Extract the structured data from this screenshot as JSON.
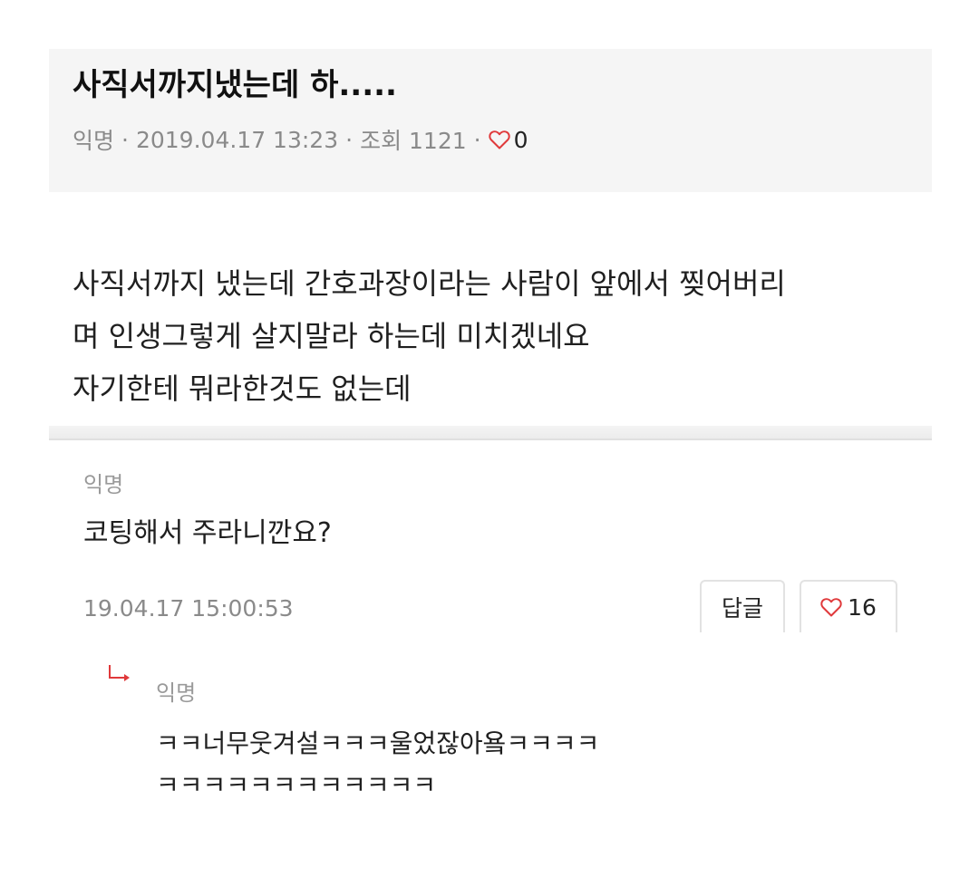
{
  "post": {
    "title": "사직서까지냈는데 하.....",
    "meta": {
      "author": "익명",
      "separator": "·",
      "date": "2019.04.17 13:23",
      "views": "조회 1121",
      "likes": "0"
    },
    "body": [
      "사직서까지 냈는데 간호과장이라는 사람이 앞에서 찢어버리",
      "며 인생그렇게 살지말라 하는데 미치겠네요",
      "자기한테 뭐라한것도 없는데"
    ]
  },
  "comment": {
    "author": "익명",
    "text": "코팅해서 주라니깐요?",
    "timestamp": "19.04.17 15:00:53",
    "reply_label": "답글",
    "likes": "16"
  },
  "reply": {
    "author": "익명",
    "lines": [
      "ㅋㅋ너무웃겨설ㅋㅋㅋ울었잖아욬ㅋㅋㅋㅋ",
      "ㅋㅋㅋㅋㅋㅋㅋㅋㅋㅋㅋㅋ"
    ]
  },
  "icons": {
    "heart": "heart-outline-icon",
    "reply_arrow": "reply-arrow-icon"
  },
  "colors": {
    "accent": "#e0393b",
    "header_bg": "#f5f5f5",
    "meta_text": "#8a8a8a"
  }
}
